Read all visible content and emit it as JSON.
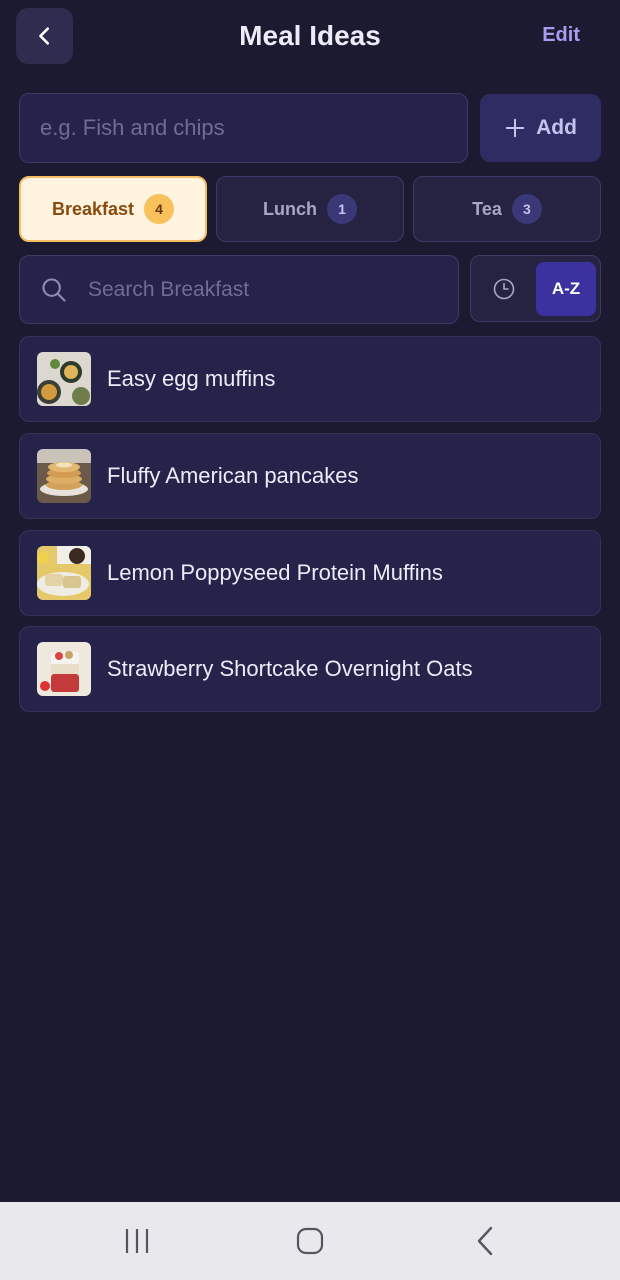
{
  "header": {
    "title": "Meal Ideas",
    "edit_label": "Edit"
  },
  "add": {
    "placeholder": "e.g. Fish and chips",
    "button_label": "Add"
  },
  "tabs": [
    {
      "label": "Breakfast",
      "count": "4",
      "active": true
    },
    {
      "label": "Lunch",
      "count": "1",
      "active": false
    },
    {
      "label": "Tea",
      "count": "3",
      "active": false
    }
  ],
  "search": {
    "placeholder": "Search Breakfast"
  },
  "sort": {
    "az_label": "A-Z",
    "active": "A-Z"
  },
  "meals": [
    {
      "name": "Easy egg muffins"
    },
    {
      "name": "Fluffy American pancakes"
    },
    {
      "name": "Lemon Poppyseed Protein Muffins"
    },
    {
      "name": "Strawberry Shortcake Overnight Oats"
    }
  ],
  "colors": {
    "background": "#1b1a30",
    "card": "#25234a",
    "accent": "#3b32a0",
    "active_tab": "#fff4e0",
    "active_badge": "#f9c15c",
    "edit_text": "#a79cf0"
  },
  "icons": {
    "back": "chevron-left-icon",
    "add": "plus-icon",
    "search": "search-icon",
    "sort_time": "clock-icon",
    "nav_recents": "recents-icon",
    "nav_home": "home-icon",
    "nav_back": "back-icon"
  }
}
